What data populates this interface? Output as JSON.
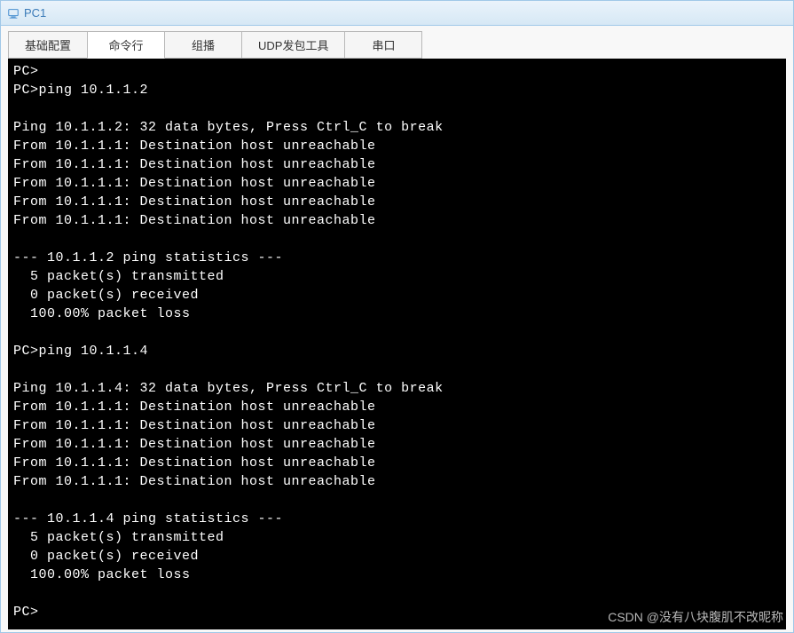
{
  "window": {
    "title": "PC1"
  },
  "tabs": [
    {
      "label": "基础配置",
      "active": false
    },
    {
      "label": "命令行",
      "active": true
    },
    {
      "label": "组播",
      "active": false
    },
    {
      "label": "UDP发包工具",
      "active": false
    },
    {
      "label": "串口",
      "active": false
    }
  ],
  "terminal": {
    "lines": [
      "PC>",
      "PC>ping 10.1.1.2",
      "",
      "Ping 10.1.1.2: 32 data bytes, Press Ctrl_C to break",
      "From 10.1.1.1: Destination host unreachable",
      "From 10.1.1.1: Destination host unreachable",
      "From 10.1.1.1: Destination host unreachable",
      "From 10.1.1.1: Destination host unreachable",
      "From 10.1.1.1: Destination host unreachable",
      "",
      "--- 10.1.1.2 ping statistics ---",
      "  5 packet(s) transmitted",
      "  0 packet(s) received",
      "  100.00% packet loss",
      "",
      "PC>ping 10.1.1.4",
      "",
      "Ping 10.1.1.4: 32 data bytes, Press Ctrl_C to break",
      "From 10.1.1.1: Destination host unreachable",
      "From 10.1.1.1: Destination host unreachable",
      "From 10.1.1.1: Destination host unreachable",
      "From 10.1.1.1: Destination host unreachable",
      "From 10.1.1.1: Destination host unreachable",
      "",
      "--- 10.1.1.4 ping statistics ---",
      "  5 packet(s) transmitted",
      "  0 packet(s) received",
      "  100.00% packet loss",
      "",
      "PC>"
    ]
  },
  "watermark": "CSDN @没有八块腹肌不改昵称"
}
